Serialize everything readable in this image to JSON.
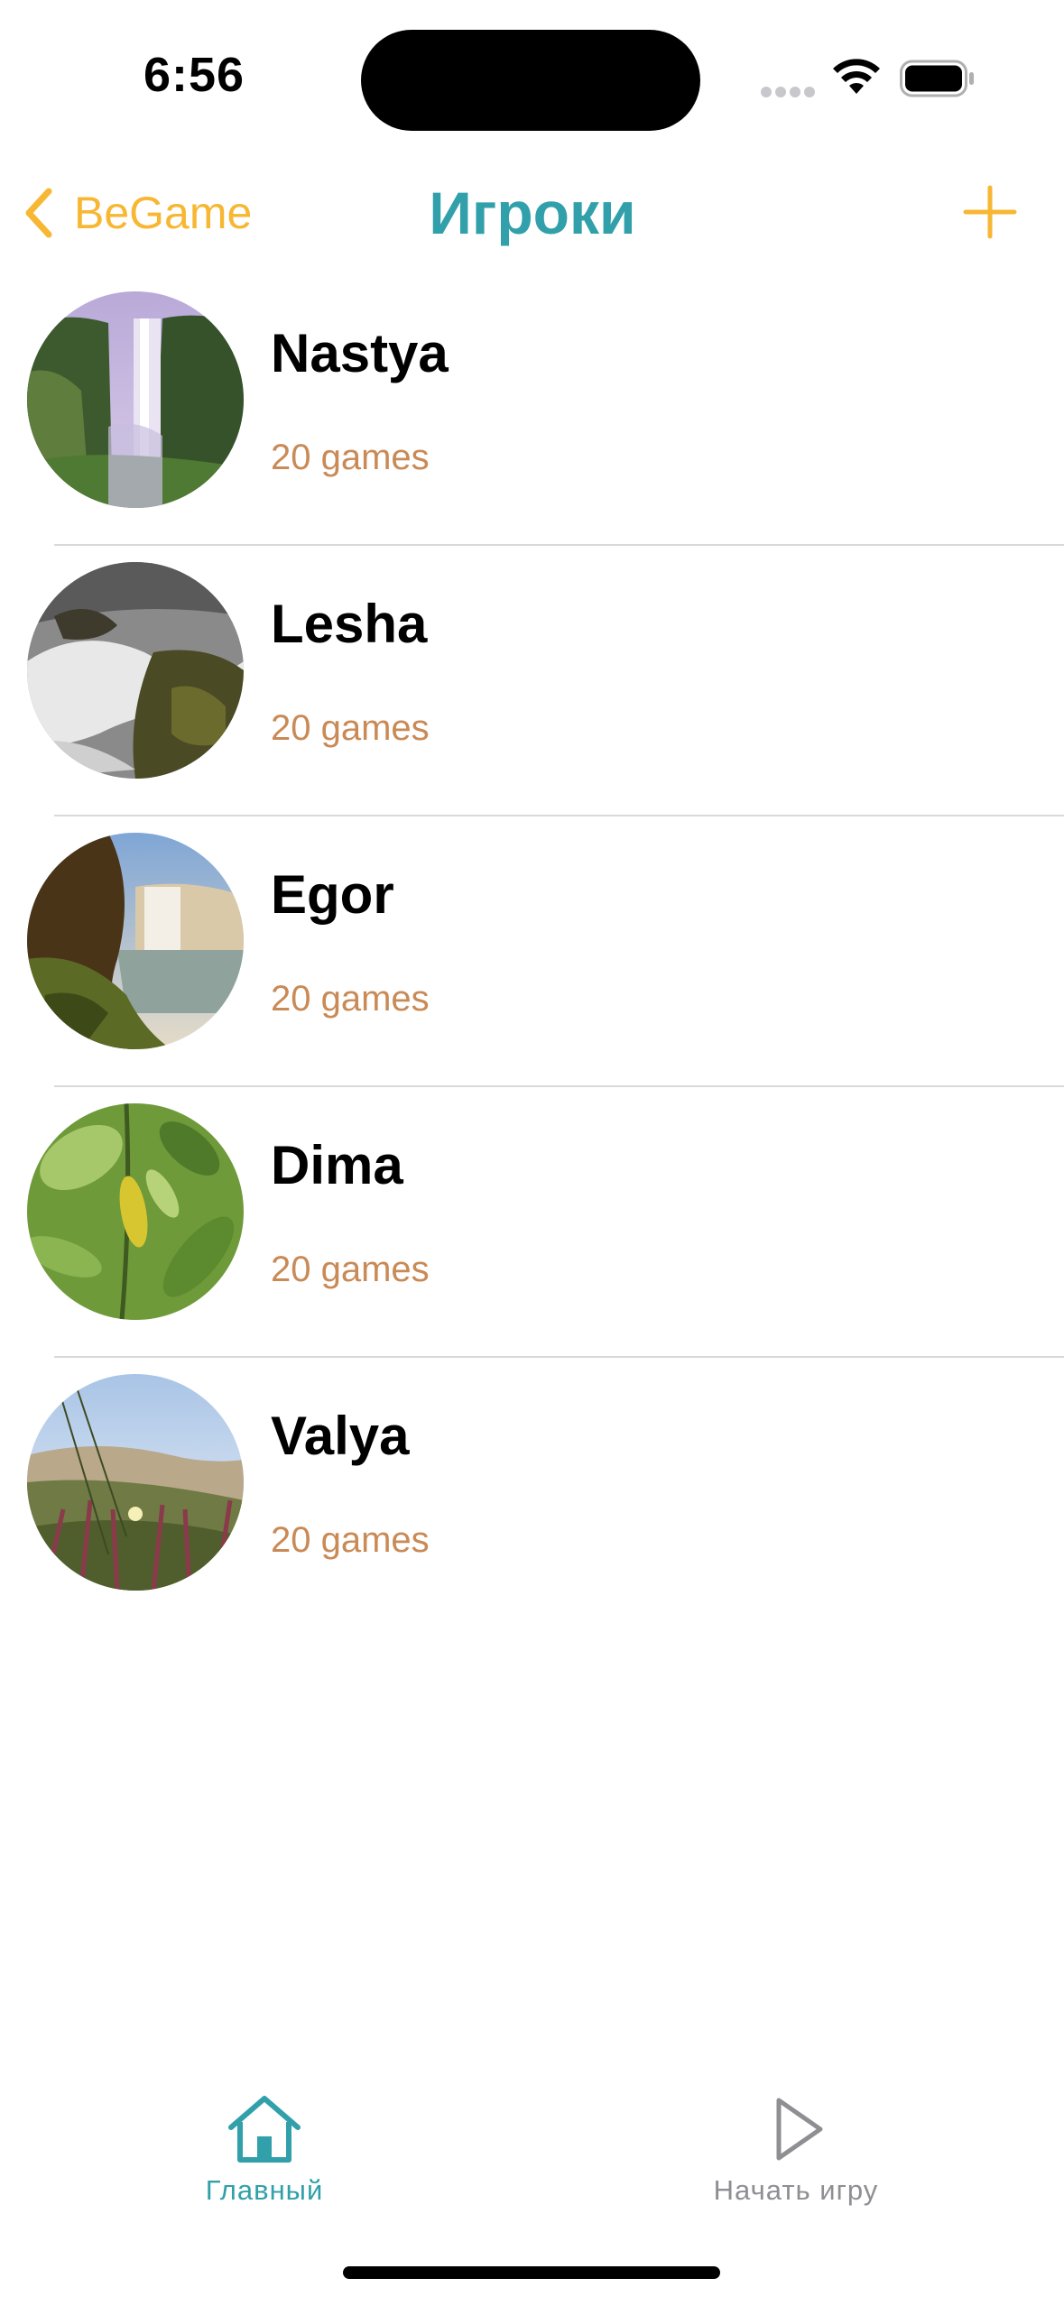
{
  "status_bar": {
    "time": "6:56",
    "icons": [
      "cellular-signal-icon",
      "wifi-icon",
      "battery-icon"
    ]
  },
  "nav": {
    "back_label": "BeGame",
    "title": "Игроки",
    "add_icon": "plus-icon",
    "accent_color": "#f7b733",
    "title_color": "#31a0aa"
  },
  "players": [
    {
      "name": "Nastya",
      "games": "20 games",
      "avatar": "waterfall-photo"
    },
    {
      "name": "Lesha",
      "games": "20 games",
      "avatar": "stream-rocks-photo"
    },
    {
      "name": "Egor",
      "games": "20 games",
      "avatar": "waterfall-cliff-photo"
    },
    {
      "name": "Dima",
      "games": "20 games",
      "avatar": "green-leaves-photo"
    },
    {
      "name": "Valya",
      "games": "20 games",
      "avatar": "dune-flowers-photo"
    }
  ],
  "tabs": [
    {
      "label": "Главный",
      "icon": "home-icon",
      "selected": true
    },
    {
      "label": "Начать игру",
      "icon": "play-icon",
      "selected": false
    }
  ],
  "colors": {
    "games_text": "#c98a56",
    "tab_active": "#31a0aa",
    "tab_inactive": "#8e8e93"
  }
}
